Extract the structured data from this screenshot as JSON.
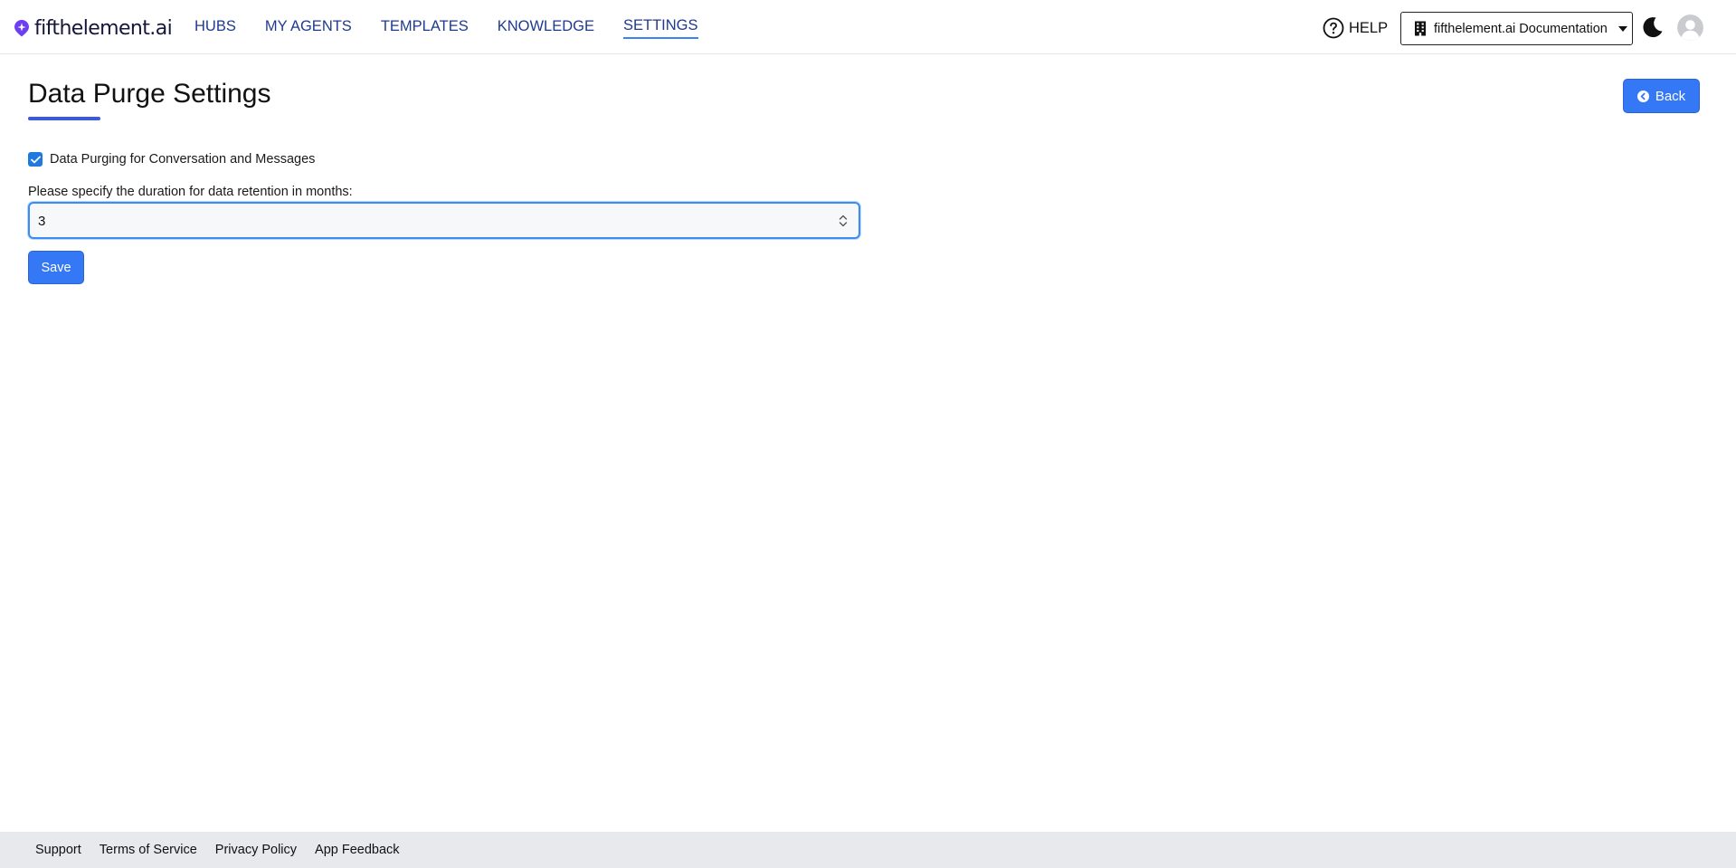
{
  "brand": {
    "name": "fifthelement.ai",
    "logo_color": "#6c3ef4"
  },
  "nav": {
    "items": [
      {
        "label": "HUBS"
      },
      {
        "label": "MY AGENTS"
      },
      {
        "label": "TEMPLATES"
      },
      {
        "label": "KNOWLEDGE"
      },
      {
        "label": "SETTINGS",
        "active": true
      }
    ]
  },
  "header": {
    "help_label": "HELP",
    "help_icon": "question-circle-icon",
    "workspace_select": {
      "selected": "fifthelement.ai Documentation",
      "icon": "building-icon"
    },
    "theme_icon": "moon-icon",
    "avatar_icon": "user-avatar-icon"
  },
  "main": {
    "title": "Data Purge Settings",
    "back_button": {
      "label": "Back",
      "icon": "circle-arrow-left-icon"
    },
    "purge_checkbox": {
      "label": "Data Purging for Conversation and Messages",
      "checked": true
    },
    "retention": {
      "label": "Please specify the duration for data retention in months:",
      "value": "3"
    },
    "save_label": "Save"
  },
  "footer": {
    "links": [
      {
        "label": "Support"
      },
      {
        "label": "Terms of Service"
      },
      {
        "label": "Privacy Policy"
      },
      {
        "label": "App Feedback"
      }
    ]
  },
  "colors": {
    "primary": "#3578f6",
    "nav_text": "#1f3a8f",
    "title_underline": "#3b57e6",
    "footer_bg": "#e8e9ed"
  }
}
